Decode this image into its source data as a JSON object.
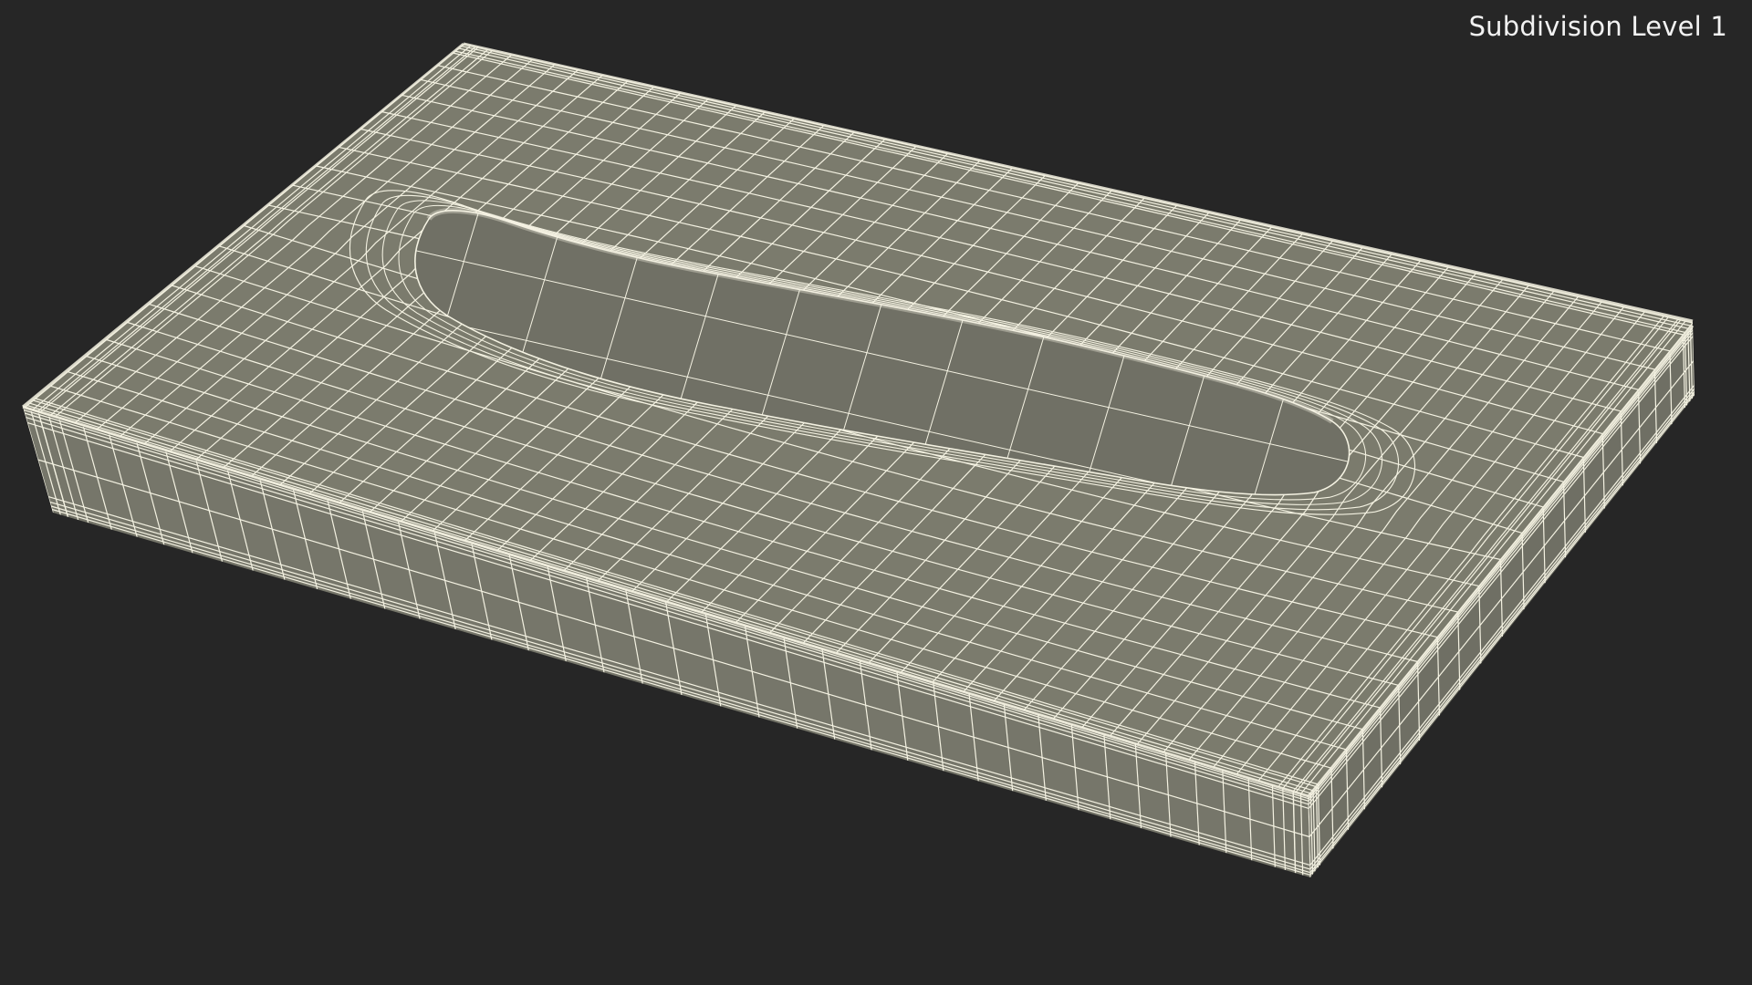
{
  "overlay": {
    "label": "Subdivision Level 1"
  },
  "render": {
    "subject": "tissue-box-wireframe",
    "colors": {
      "background": "#262626",
      "surface_top": "#7b7b6d",
      "surface_front": "#76766a",
      "surface_side": "#6f6f64",
      "opening": "#707065",
      "wire": "#f4f2e2"
    }
  }
}
